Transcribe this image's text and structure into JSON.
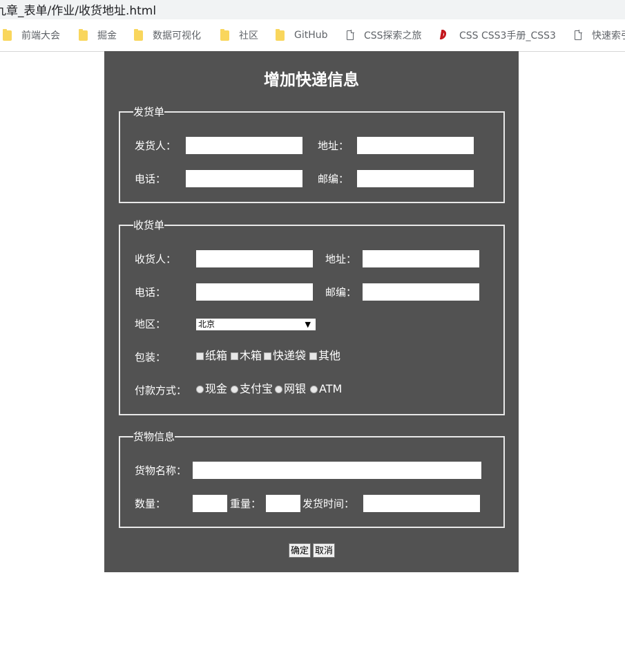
{
  "browser": {
    "address": "九章_表单/作业/收货地址.html",
    "bookmarks": [
      {
        "label": "前端大会",
        "icon": "folder-icon"
      },
      {
        "label": "掘金",
        "icon": "folder-icon"
      },
      {
        "label": "数据可视化",
        "icon": "folder-icon"
      },
      {
        "label": "社区",
        "icon": "folder-icon"
      },
      {
        "label": "GitHub",
        "icon": "folder-icon"
      },
      {
        "label": "CSS探索之旅",
        "icon": "page-icon"
      },
      {
        "label": "CSS CSS3手册_CSS3",
        "icon": "d-logo-icon"
      },
      {
        "label": "快速索引",
        "icon": "page-icon"
      }
    ]
  },
  "form": {
    "title": "增加快递信息",
    "sender": {
      "legend": "发货单",
      "name_label": "发货人：",
      "address_label": "地址：",
      "phone_label": "电话：",
      "zip_label": "邮编："
    },
    "receiver": {
      "legend": "收货单",
      "name_label": "收货人：",
      "address_label": "地址：",
      "phone_label": "电话：",
      "zip_label": "邮编：",
      "region_label": "地区：",
      "region_selected": "北京",
      "packaging_label": "包装：",
      "packaging_options": [
        "纸箱",
        "木箱",
        "快递袋",
        "其他"
      ],
      "payment_label": "付款方式：",
      "payment_options": [
        "现金",
        "支付宝",
        "网银",
        "ATM"
      ]
    },
    "goods": {
      "legend": "货物信息",
      "name_label": "货物名称：",
      "quantity_label": "数量：",
      "weight_label": "重量：",
      "ship_time_label": "发货时间："
    },
    "buttons": {
      "confirm": "确定",
      "cancel": "取消"
    }
  },
  "colors": {
    "panel_bg": "#525252",
    "border": "#e9e9e9",
    "text": "#ffffff"
  }
}
